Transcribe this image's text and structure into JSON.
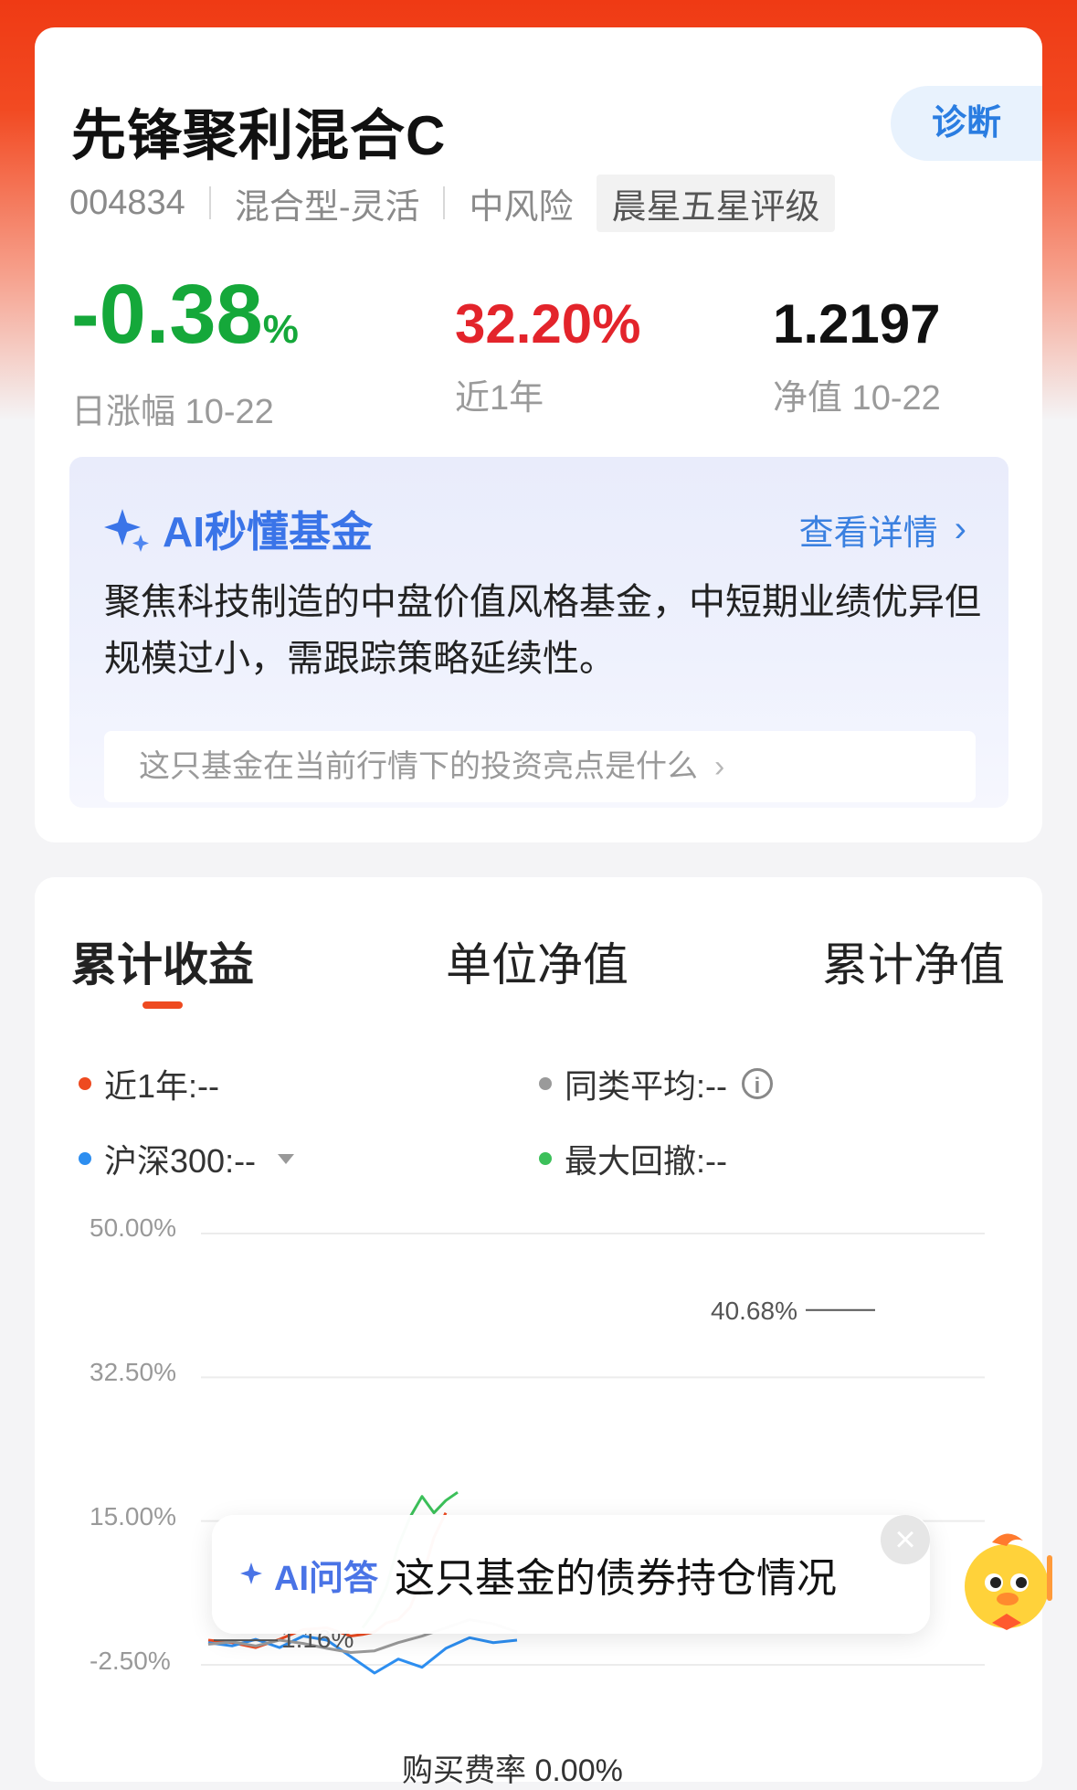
{
  "fund": {
    "name": "先锋聚利混合C",
    "diagnose_label": "诊断",
    "code": "004834",
    "type": "混合型-灵活",
    "risk": "中风险",
    "rating": "晨星五星评级",
    "day_change_value": "-0.38",
    "day_change_unit": "%",
    "day_change_label": "日涨幅 10-22",
    "year_return_value": "32.20%",
    "year_return_label": "近1年",
    "nav_value": "1.2197",
    "nav_label": "净值 10-22",
    "colors": {
      "down": "#15a83a",
      "up": "#e3242b",
      "accent": "#ee4a20",
      "ai_blue": "#3a74e8"
    }
  },
  "ai_card": {
    "title": "AI秒懂基金",
    "detail_link": "查看详情",
    "summary": "聚焦科技制造的中盘价值风格基金，中短期业绩优异但规模过小，需跟踪策略延续性。",
    "question": "这只基金在当前行情下的投资亮点是什么"
  },
  "chart_panel": {
    "tabs": [
      "累计收益",
      "单位净值",
      "累计净值"
    ],
    "active_tab": 0,
    "legend": {
      "year": "近1年:--",
      "avg": "同类平均:--",
      "hs300": "沪深300:--",
      "max_dd": "最大回撤:--"
    },
    "legend_colors": {
      "year": "#ee4a20",
      "avg": "#9a9a9a",
      "hs300": "#2d8ef0",
      "max_dd": "#3cc05a"
    }
  },
  "chart_data": {
    "type": "line",
    "ylim": [
      -2.5,
      50
    ],
    "yticks": [
      "50.00%",
      "32.50%",
      "15.00%",
      "-2.50%"
    ],
    "annotations": [
      {
        "text": "40.68%",
        "y": 40.68
      },
      {
        "text": "1.16%",
        "y": 1.16
      }
    ],
    "series": [
      {
        "color": "#ee4a20",
        "x": [
          0,
          1,
          2,
          3,
          4,
          5,
          6,
          6.5,
          7,
          7.5,
          8,
          8.5,
          9,
          9.5,
          10
        ],
        "values": [
          0.5,
          0.2,
          -0.4,
          0.6,
          1.8,
          2.0,
          1.0,
          1.2,
          1.5,
          2.6,
          3.0,
          4.5,
          8.0,
          13.0,
          16.0
        ]
      },
      {
        "color": "#3cc05a",
        "x": [
          6.5,
          7,
          7.5,
          8,
          8.5,
          9,
          9.5,
          10,
          10.5
        ],
        "values": [
          2.0,
          4.0,
          7.0,
          12.0,
          15.5,
          18.0,
          16.0,
          17.5,
          18.5
        ]
      },
      {
        "color": "#2d8ef0",
        "x": [
          0,
          1,
          2,
          3,
          4,
          5,
          6,
          7,
          8,
          9,
          10,
          11,
          12,
          13
        ],
        "values": [
          0.2,
          -0.2,
          0.6,
          -0.4,
          1.0,
          0.5,
          -1.5,
          -3.5,
          -1.8,
          -2.8,
          -0.5,
          0.8,
          0.2,
          0.5
        ]
      },
      {
        "color": "#9a9a9a",
        "x": [
          0,
          1,
          2,
          3,
          4,
          5,
          6,
          7,
          8,
          9,
          10,
          11,
          12,
          13
        ],
        "values": [
          0.0,
          0.3,
          -0.2,
          0.5,
          0.1,
          -0.5,
          -1.0,
          -0.8,
          0.2,
          1.0,
          2.0,
          3.0,
          2.5,
          1.5
        ]
      }
    ]
  },
  "ai_pill": {
    "tag": "AI问答",
    "question": "这只基金的债券持仓情况",
    "close_icon": "close-icon"
  },
  "bottom_peek": "购买费率 0.00%"
}
